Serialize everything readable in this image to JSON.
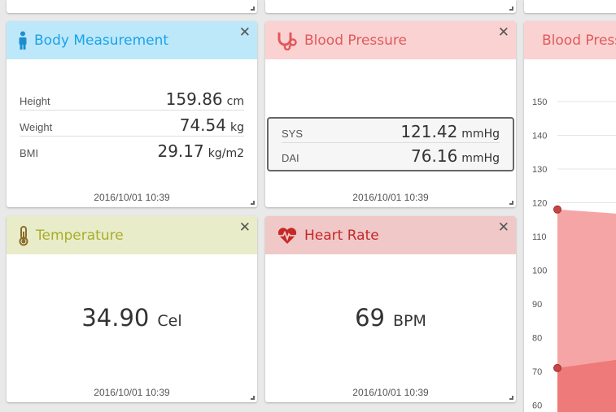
{
  "cards": {
    "body": {
      "title": "Body Measurement",
      "close": "✕",
      "rows": [
        {
          "label": "Height",
          "value": "159.86",
          "unit": "cm"
        },
        {
          "label": "Weight",
          "value": "74.54",
          "unit": "kg"
        },
        {
          "label": "BMI",
          "value": "29.17",
          "unit": "kg/m2"
        }
      ],
      "timestamp": "2016/10/01 10:39",
      "colors": {
        "header": "#bde8fa",
        "title": "#1aa3e8",
        "icon": "#1b8ed0"
      },
      "icon": "person-icon"
    },
    "bp": {
      "title": "Blood Pressure",
      "close": "✕",
      "rows": [
        {
          "label": "SYS",
          "value": "121.42",
          "unit": "mmHg"
        },
        {
          "label": "DAI",
          "value": "76.16",
          "unit": "mmHg"
        }
      ],
      "timestamp": "2016/10/01 10:39",
      "colors": {
        "header": "#fbd2d2",
        "title": "#e05a5a"
      },
      "icon": "stethoscope-icon"
    },
    "temp": {
      "title": "Temperature",
      "close": "✕",
      "value": "34.90",
      "unit": "Cel",
      "timestamp": "2016/10/01 10:39",
      "colors": {
        "header": "#e9ecc8",
        "title": "#a8ad2a"
      },
      "icon": "thermometer-icon"
    },
    "hr": {
      "title": "Heart Rate",
      "close": "✕",
      "value": "69",
      "unit": "BPM",
      "timestamp": "2016/10/01 10:39",
      "colors": {
        "header": "#f0c8c8",
        "title": "#c62828"
      },
      "icon": "heartbeat-icon"
    },
    "bp_chart": {
      "title": "Blood Pressure",
      "colors": {
        "header": "#fbd2d2",
        "title": "#e05a5a",
        "sys_fill": "#f5a5a5",
        "dia_fill": "#ef7a7a",
        "point": "#c64545"
      },
      "icon": "area-chart-icon"
    }
  },
  "chart_data": {
    "type": "area",
    "ylim": [
      60,
      150
    ],
    "yticks": [
      "150",
      "140",
      "130",
      "120",
      "110",
      "100",
      "90",
      "80",
      "70",
      "60"
    ],
    "series": [
      {
        "values": [
          118,
          116
        ]
      },
      {
        "values": [
          71,
          75
        ]
      }
    ]
  }
}
